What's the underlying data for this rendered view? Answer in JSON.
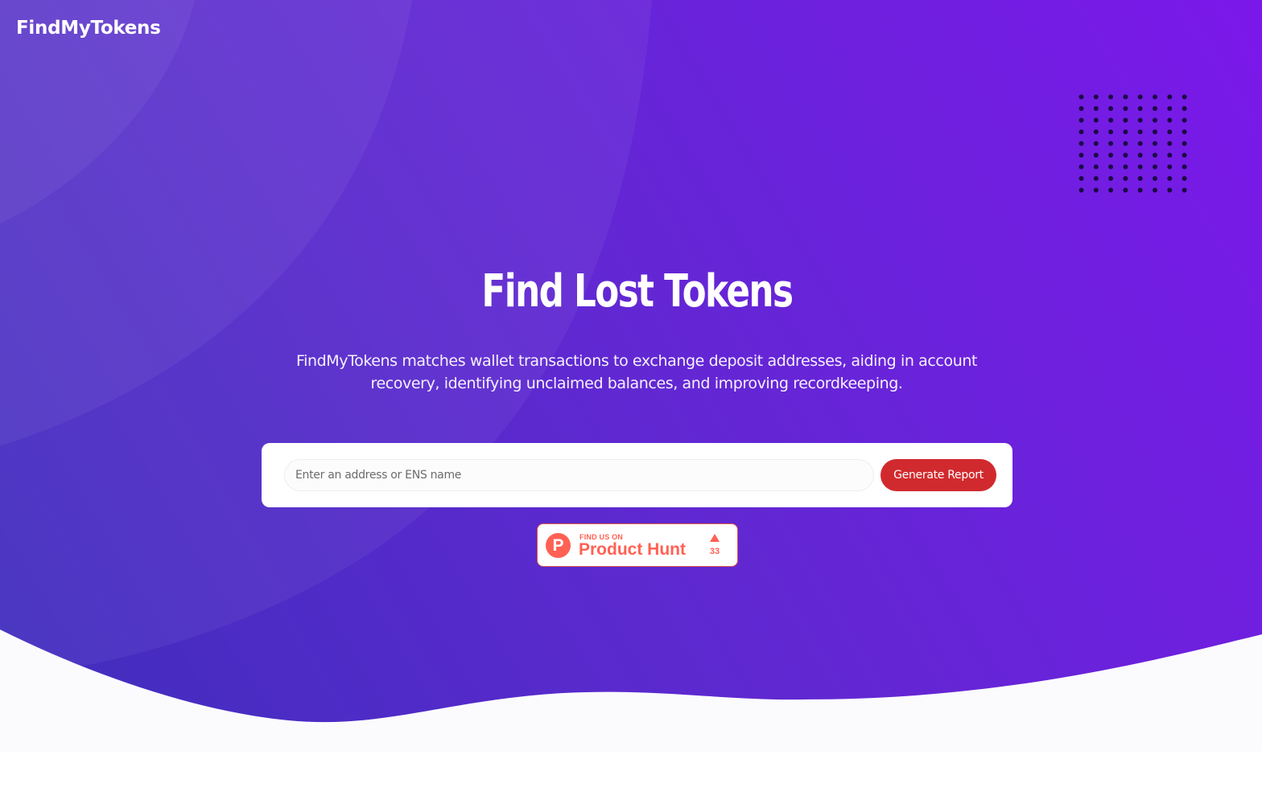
{
  "header": {
    "brand": "FindMyTokens"
  },
  "hero": {
    "title": "Find Lost Tokens",
    "description": "FindMyTokens matches wallet transactions to exchange deposit addresses, aiding in account recovery, identifying unclaimed balances, and improving recordkeeping."
  },
  "search": {
    "placeholder": "Enter an address or ENS name",
    "value": "",
    "button_label": "Generate Report"
  },
  "product_hunt": {
    "kicker": "FIND US ON",
    "name": "Product Hunt",
    "logo_letter": "P",
    "upvote_icon": "triangle-up-icon",
    "upvotes": "33"
  },
  "colors": {
    "gradient_start": "#3f2ebc",
    "gradient_mid": "#6128d2",
    "gradient_end": "#7b18ea",
    "button": "#d12a2e",
    "product_hunt": "#ff6154",
    "dot_grid": "#1b0a45",
    "page_bottom": "#fbfbfe"
  }
}
